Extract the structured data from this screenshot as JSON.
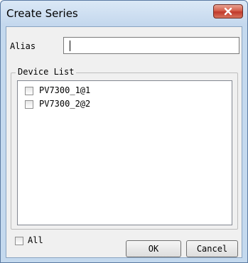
{
  "window": {
    "title": "Create Series"
  },
  "alias": {
    "label": "Alias",
    "value": ""
  },
  "device_list": {
    "title": "Device List",
    "items": [
      {
        "label": "PV7300_1@1",
        "checked": false
      },
      {
        "label": "PV7300_2@2",
        "checked": false
      }
    ]
  },
  "footer": {
    "all_label": "All",
    "all_checked": false,
    "ok_label": "OK",
    "cancel_label": "Cancel"
  },
  "colors": {
    "titlebar": "#c4d9ee",
    "close_button": "#c0392b"
  },
  "icons": {
    "close": "close-icon"
  }
}
